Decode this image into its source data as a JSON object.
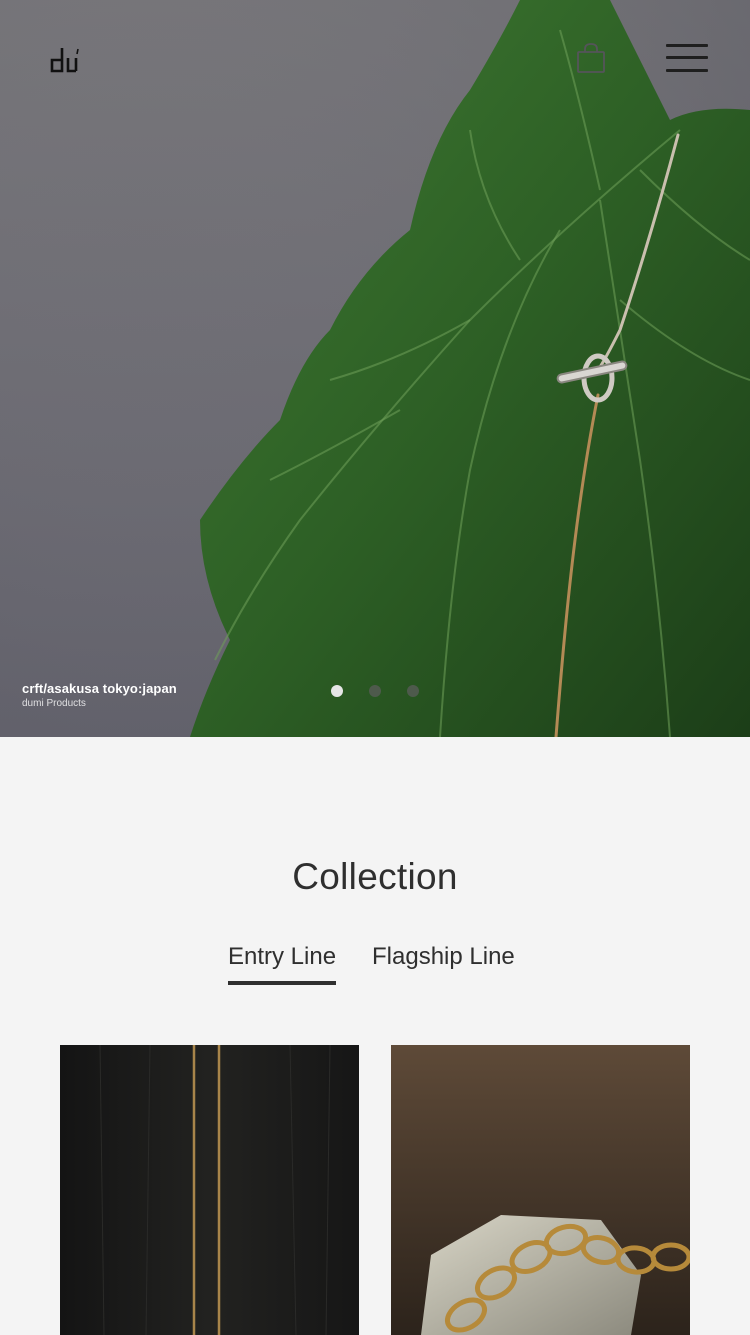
{
  "header": {
    "logo_text": "dumi",
    "icons": {
      "bag": "shopping-bag-icon",
      "menu": "hamburger-menu-icon"
    }
  },
  "hero": {
    "caption_title": "crft/asakusa tokyo:japan",
    "caption_subtitle": "dumi Products",
    "slides_total": 3,
    "active_slide": 1
  },
  "collection": {
    "title": "Collection",
    "tabs": [
      {
        "label": "Entry Line",
        "active": true
      },
      {
        "label": "Flagship Line",
        "active": false
      }
    ],
    "products": [
      {
        "image": "gold-box-chain-on-dark-wood"
      },
      {
        "image": "gold-link-chain-on-quartz"
      }
    ]
  },
  "colors": {
    "background": "#f4f4f4",
    "text": "#2f2f2f",
    "dot_active": "#e6e6e6",
    "dot_inactive": "#4e5a4c"
  }
}
